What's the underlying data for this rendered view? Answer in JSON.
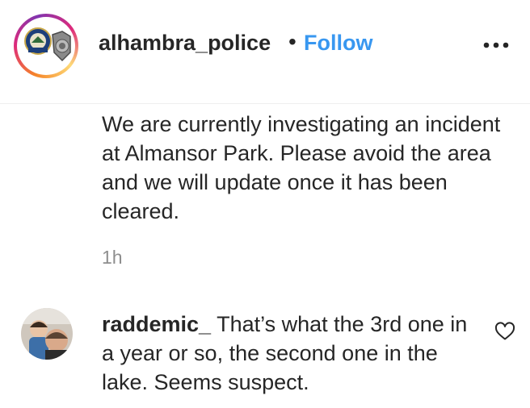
{
  "post": {
    "author": "alhambra_police",
    "separator": "•",
    "follow_label": "Follow",
    "more_icon": "more-horizontal-icon",
    "caption": "We are currently investigating an incident at Almansor Park. Please avoid the area and we will update once it has been cleared.",
    "time": "1h"
  },
  "comment": {
    "username": "raddemic_",
    "text": "That’s what the 3rd one in a year or so, the second one in the lake. Seems suspect.",
    "like_icon": "heart-outline-icon"
  },
  "colors": {
    "link_blue": "#3897f0",
    "text": "#262626",
    "muted": "#8e8e8e"
  }
}
